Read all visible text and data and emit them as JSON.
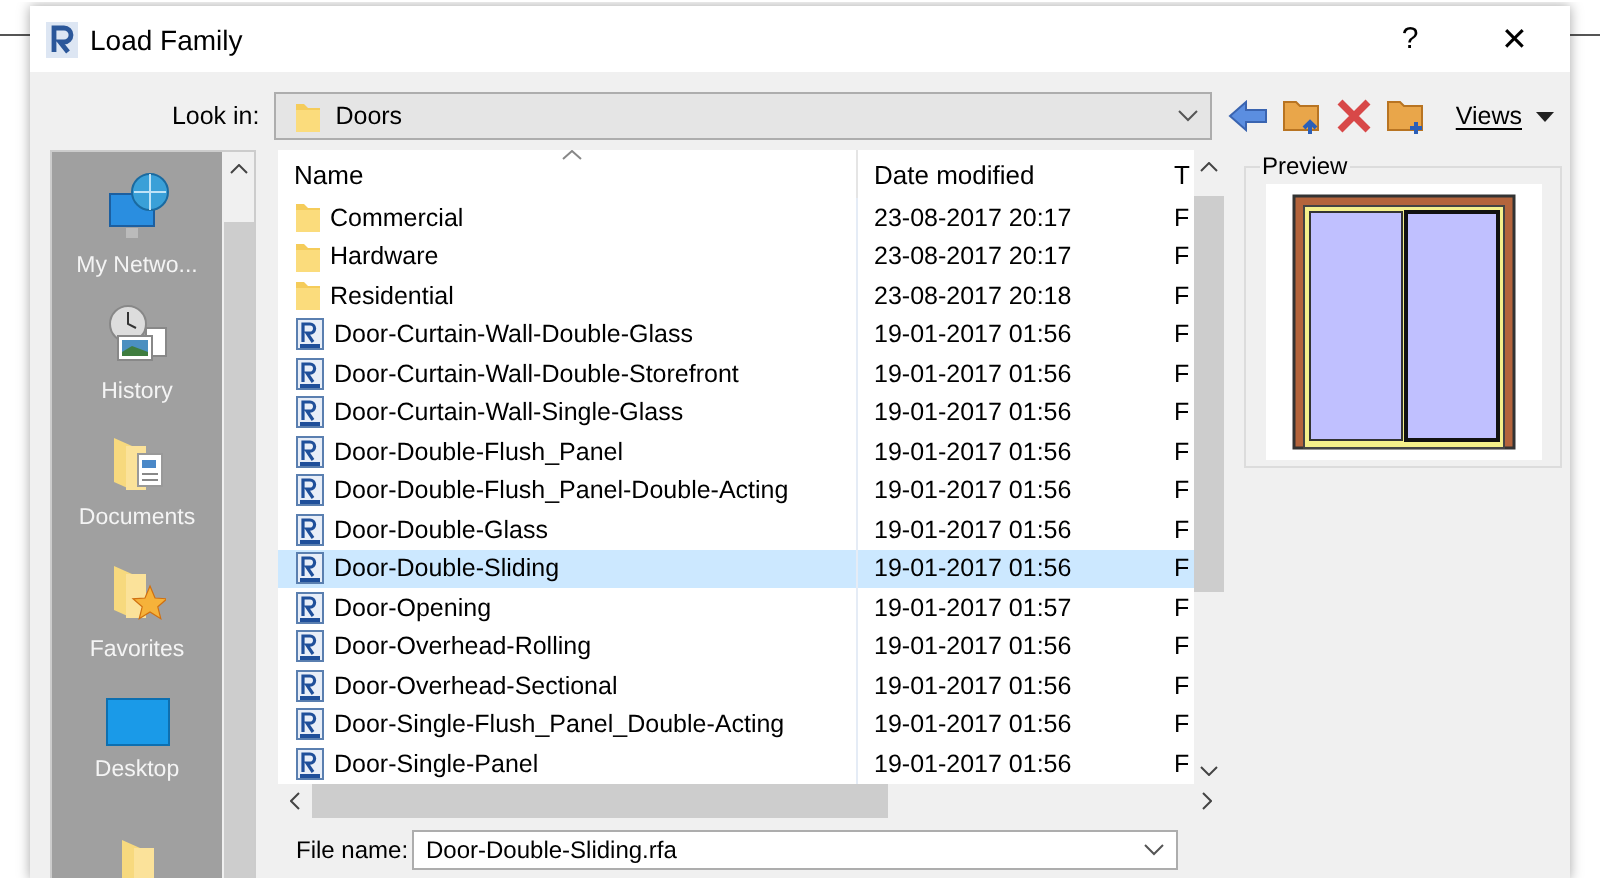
{
  "window": {
    "title": "Load Family",
    "help": "?",
    "close": "✕"
  },
  "look_in": {
    "label": "Look in:",
    "value": "Doors"
  },
  "toolbar": {
    "views": "Views"
  },
  "places": [
    {
      "label": "My Netwo...",
      "kind": "network"
    },
    {
      "label": "History",
      "kind": "history"
    },
    {
      "label": "Documents",
      "kind": "documents"
    },
    {
      "label": "Favorites",
      "kind": "favorites"
    },
    {
      "label": "Desktop",
      "kind": "desktop"
    },
    {
      "kind": "folder"
    }
  ],
  "table": {
    "columns": [
      "Name",
      "Date modified",
      "T"
    ],
    "rows": [
      {
        "kind": "folder",
        "name": "Commercial",
        "date": "23-08-2017 20:17",
        "type": "F",
        "selected": false
      },
      {
        "kind": "folder",
        "name": "Hardware",
        "date": "23-08-2017 20:17",
        "type": "F",
        "selected": false
      },
      {
        "kind": "folder",
        "name": "Residential",
        "date": "23-08-2017 20:18",
        "type": "F",
        "selected": false
      },
      {
        "kind": "family",
        "name": "Door-Curtain-Wall-Double-Glass",
        "date": "19-01-2017 01:56",
        "type": "F",
        "selected": false
      },
      {
        "kind": "family",
        "name": "Door-Curtain-Wall-Double-Storefront",
        "date": "19-01-2017 01:56",
        "type": "F",
        "selected": false
      },
      {
        "kind": "family",
        "name": "Door-Curtain-Wall-Single-Glass",
        "date": "19-01-2017 01:56",
        "type": "F",
        "selected": false
      },
      {
        "kind": "family",
        "name": "Door-Double-Flush_Panel",
        "date": "19-01-2017 01:56",
        "type": "F",
        "selected": false
      },
      {
        "kind": "family",
        "name": "Door-Double-Flush_Panel-Double-Acting",
        "date": "19-01-2017 01:56",
        "type": "F",
        "selected": false
      },
      {
        "kind": "family",
        "name": "Door-Double-Glass",
        "date": "19-01-2017 01:56",
        "type": "F",
        "selected": false
      },
      {
        "kind": "family",
        "name": "Door-Double-Sliding",
        "date": "19-01-2017 01:56",
        "type": "F",
        "selected": true
      },
      {
        "kind": "family",
        "name": "Door-Opening",
        "date": "19-01-2017 01:57",
        "type": "F",
        "selected": false
      },
      {
        "kind": "family",
        "name": "Door-Overhead-Rolling",
        "date": "19-01-2017 01:56",
        "type": "F",
        "selected": false
      },
      {
        "kind": "family",
        "name": "Door-Overhead-Sectional",
        "date": "19-01-2017 01:56",
        "type": "F",
        "selected": false
      },
      {
        "kind": "family",
        "name": "Door-Single-Flush_Panel_Double-Acting",
        "date": "19-01-2017 01:56",
        "type": "F",
        "selected": false
      },
      {
        "kind": "family",
        "name": "Door-Single-Panel",
        "date": "19-01-2017 01:56",
        "type": "F",
        "selected": false
      }
    ]
  },
  "preview": {
    "label": "Preview"
  },
  "file_name": {
    "label": "File name:",
    "value": "Door-Double-Sliding.rfa"
  }
}
